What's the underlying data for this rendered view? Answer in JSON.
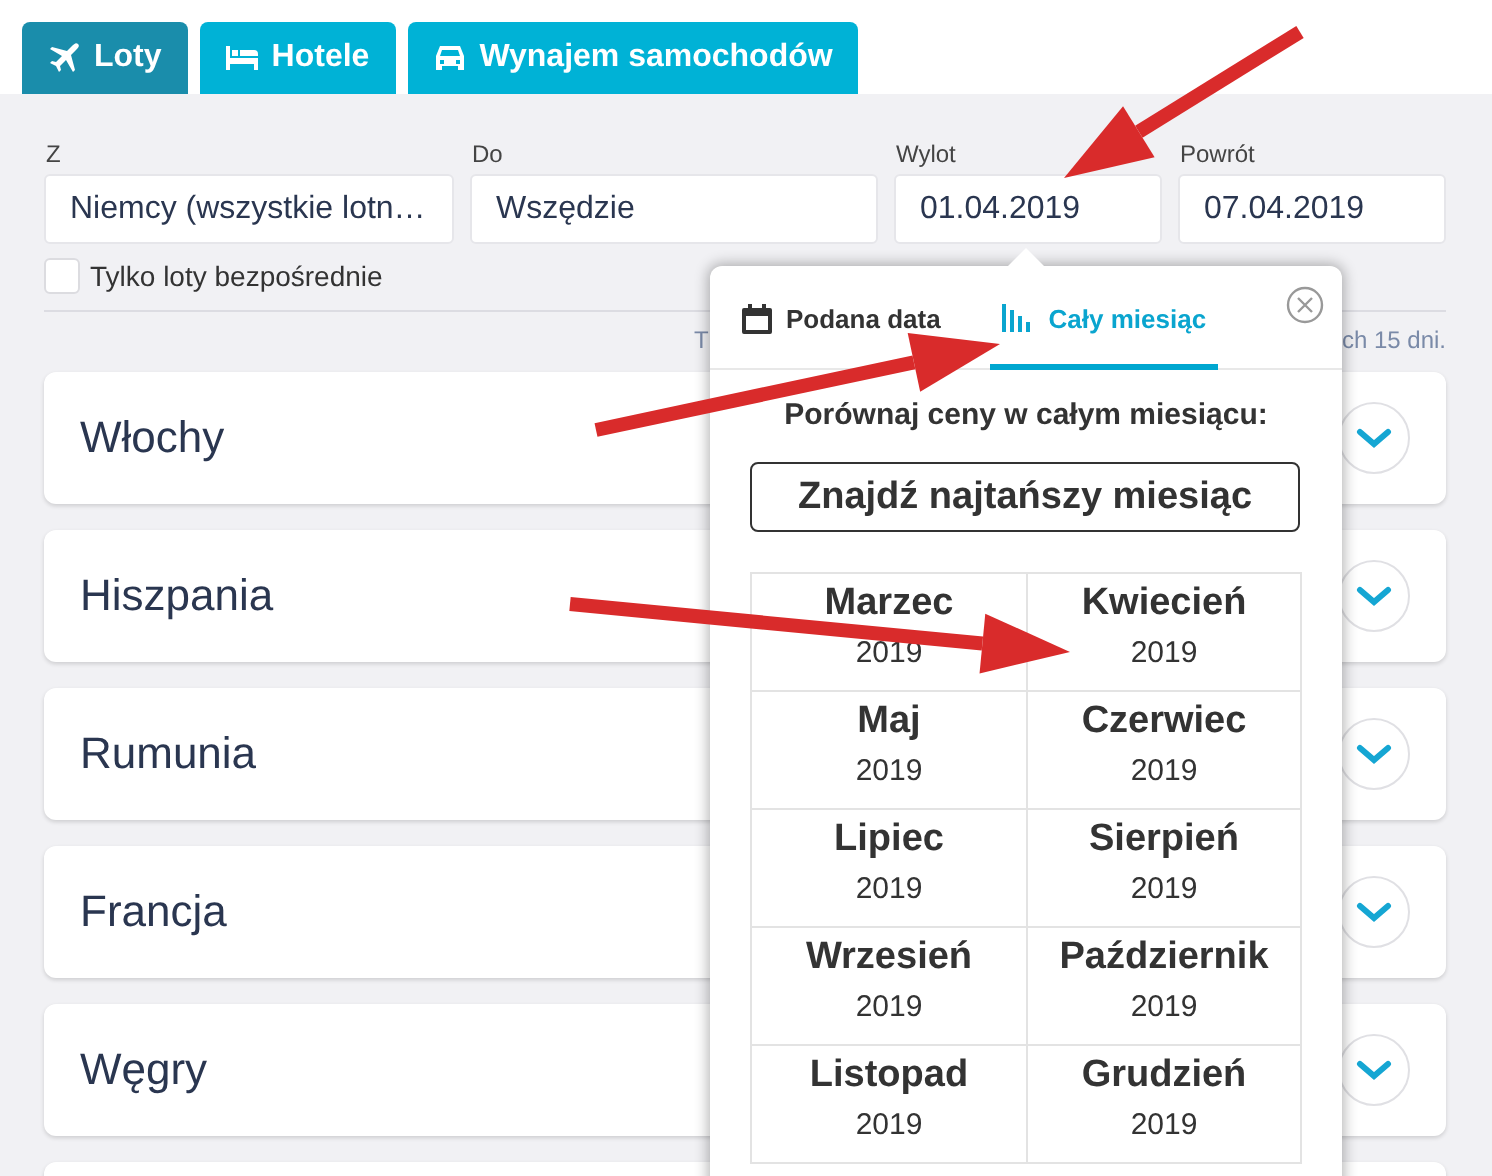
{
  "tabs": [
    {
      "label": "Loty",
      "selected": true
    },
    {
      "label": "Hotele",
      "selected": false
    },
    {
      "label": "Wynajem samochodów",
      "selected": false
    }
  ],
  "fields": [
    {
      "label": "Z",
      "value": "Niemcy (wszystkie lotn…"
    },
    {
      "label": "Do",
      "value": "Wszędzie"
    },
    {
      "label": "Wylot",
      "value": "01.04.2019"
    },
    {
      "label": "Powrót",
      "value": "07.04.2019"
    }
  ],
  "direct_only": {
    "label": "Tylko loty bezpośrednie",
    "checked": false
  },
  "hint": {
    "left": "T",
    "right": "ch 15 dni."
  },
  "results": [
    {
      "name": "Włochy"
    },
    {
      "name": "Hiszpania"
    },
    {
      "name": "Rumunia"
    },
    {
      "name": "Francja"
    },
    {
      "name": "Węgry"
    }
  ],
  "date_popup": {
    "tabs": [
      {
        "label": "Podana data",
        "selected": false
      },
      {
        "label": "Cały miesiąc",
        "selected": true
      }
    ],
    "prompt": "Porównaj ceny w całym miesiącu:",
    "button": "Znajdź najtańszy miesiąc",
    "months": [
      {
        "month": "Marzec",
        "year": "2019"
      },
      {
        "month": "Kwiecień",
        "year": "2019"
      },
      {
        "month": "Maj",
        "year": "2019"
      },
      {
        "month": "Czerwiec",
        "year": "2019"
      },
      {
        "month": "Lipiec",
        "year": "2019"
      },
      {
        "month": "Sierpień",
        "year": "2019"
      },
      {
        "month": "Wrzesień",
        "year": "2019"
      },
      {
        "month": "Październik",
        "year": "2019"
      },
      {
        "month": "Listopad",
        "year": "2019"
      },
      {
        "month": "Grudzień",
        "year": "2019"
      }
    ]
  }
}
